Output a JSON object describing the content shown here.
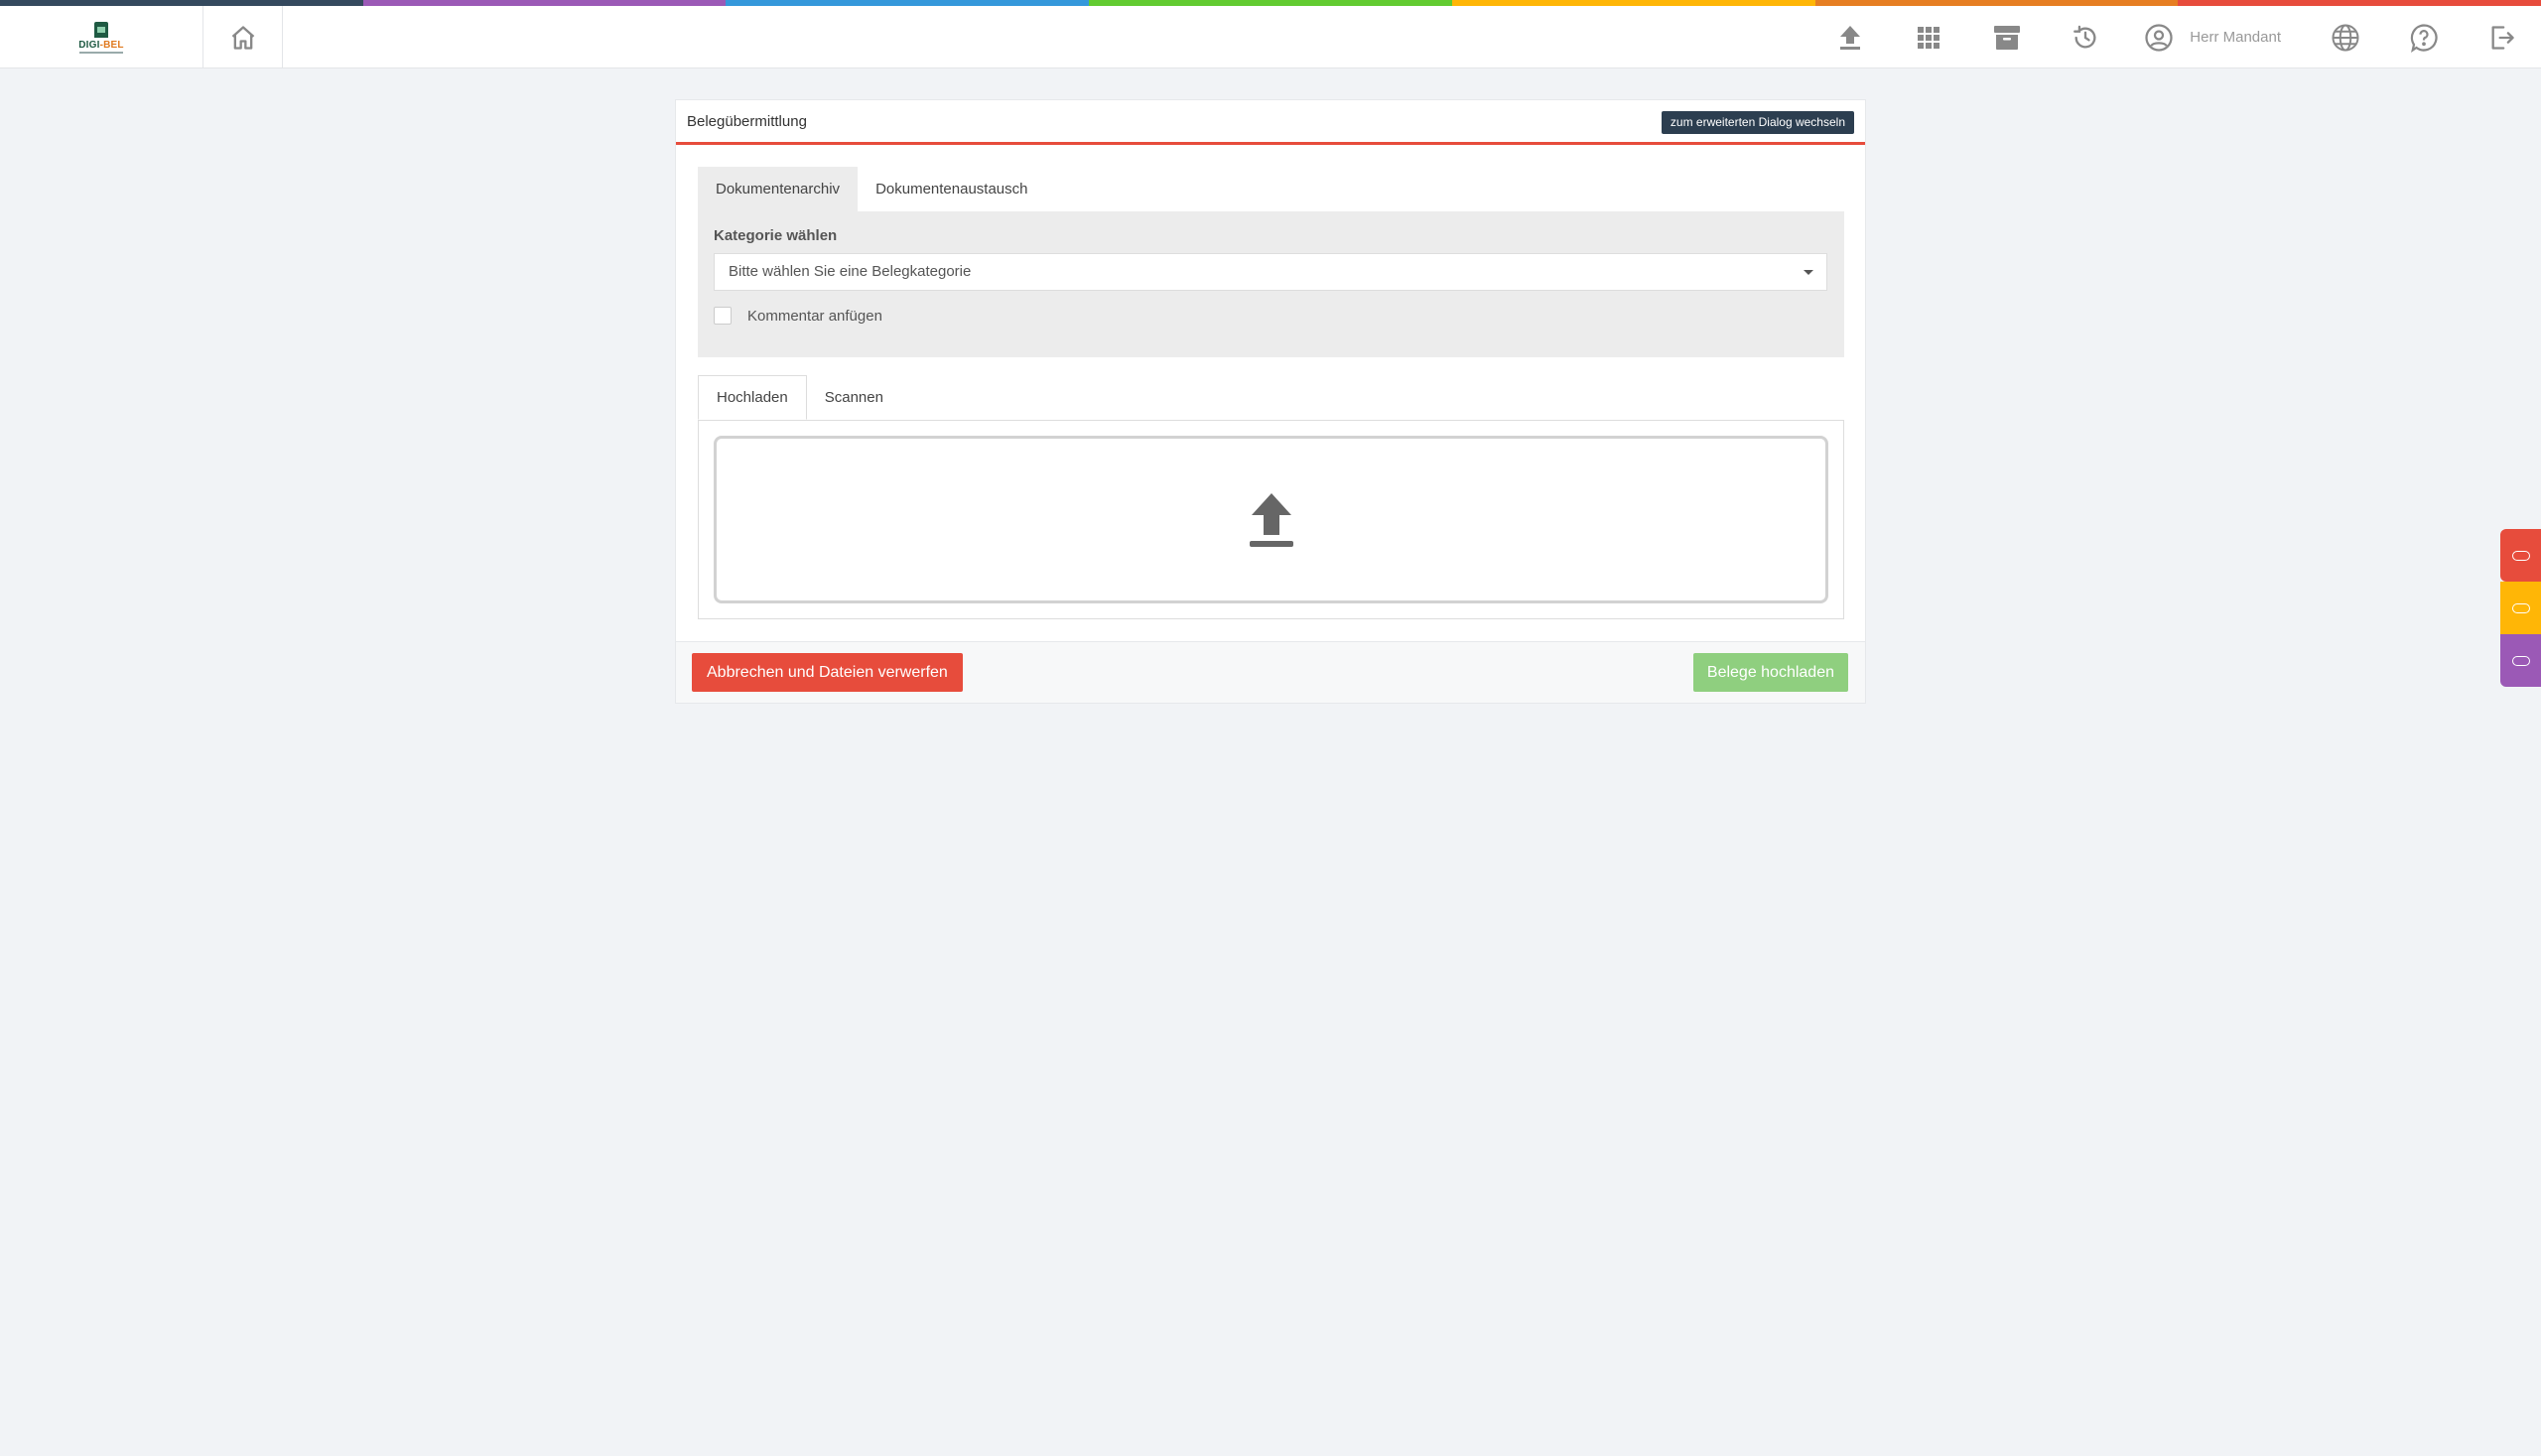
{
  "colors": {
    "strip": [
      "#34495e",
      "#9b59b6",
      "#3498db",
      "#62cb31",
      "#ffb606",
      "#e67e22",
      "#e74c3c"
    ],
    "accent": "#e74c3c",
    "side_tabs": [
      "#e74c3c",
      "#ffb606",
      "#9b59b6"
    ]
  },
  "brand": {
    "logo_part1": "DIGI",
    "logo_part2": "-BEL"
  },
  "topbar": {
    "icons": [
      "upload-icon",
      "apps-grid-icon",
      "archive-icon",
      "history-icon"
    ],
    "user_name": "Herr Mandant",
    "right_icons": [
      "globe-icon",
      "help-icon",
      "logout-icon"
    ]
  },
  "panel": {
    "title": "Belegübermittlung",
    "switch_label": "zum erweiterten Dialog wechseln",
    "doc_tabs": [
      "Dokumentenarchiv",
      "Dokumentenaustausch"
    ],
    "category_label": "Kategorie wählen",
    "category_placeholder": "Bitte wählen Sie eine Belegkategorie",
    "comment_label": "Kommentar anfügen",
    "upload_tabs": [
      "Hochladen",
      "Scannen"
    ],
    "cancel_label": "Abbrechen und Dateien verwerfen",
    "upload_label": "Belege hochladen"
  }
}
